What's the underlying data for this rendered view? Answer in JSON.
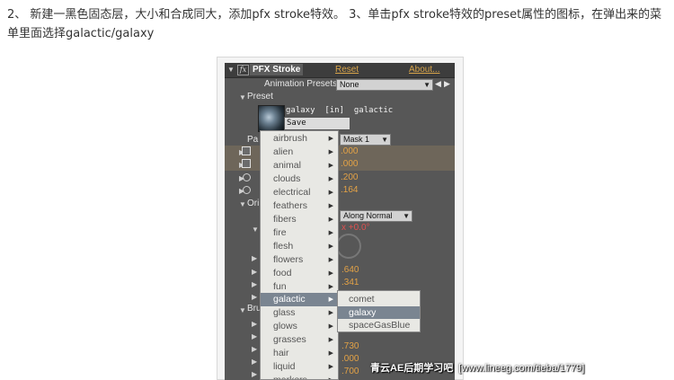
{
  "article": {
    "paragraph": "2、 新建一黑色固态层，大小和合成同大，添加pfx stroke特效。 3、单击pfx stroke特效的preset属性的图标，在弹出来的菜单里面选择galactic/galaxy"
  },
  "effect_panel": {
    "effect_name": "PFX Stroke",
    "reset_label": "Reset",
    "about_label": "About...",
    "animation_presets_label": "Animation Presets:",
    "animation_presets_value": "None",
    "preset_section_label": "Preset",
    "preset_info": "galaxy  [in]  galactic",
    "save_preset_label": "Save Preset...",
    "path_label": "Pa",
    "path_value": "Mask 1",
    "prop_values": [
      ".000",
      ".000",
      ".200",
      ".164"
    ],
    "orient_label": "Ori",
    "orient_value": "Along Normal",
    "angle_value": "x +0.0°",
    "lower_values": [
      ".640",
      ".341"
    ],
    "brush_label": "Bru",
    "bottom_values": [
      ".730",
      ".000",
      ".700"
    ]
  },
  "preset_menu": {
    "items": [
      "airbrush",
      "alien",
      "animal",
      "clouds",
      "electrical",
      "feathers",
      "fibers",
      "fire",
      "flesh",
      "flowers",
      "food",
      "fun",
      "galactic",
      "glass",
      "glows",
      "grasses",
      "hair",
      "liquid",
      "markers"
    ],
    "selected": "galactic"
  },
  "galactic_submenu": {
    "items": [
      "comet",
      "galaxy",
      "spaceGasBlue"
    ],
    "selected": "galaxy"
  },
  "watermark": {
    "brand": "青云AE后期学习吧",
    "url": "[www.lineeg.com/tieba/1779]"
  },
  "colors": {
    "value_orange": "#e3a246",
    "menu_selected": "#7a8591",
    "panel_bg": "#575757"
  }
}
